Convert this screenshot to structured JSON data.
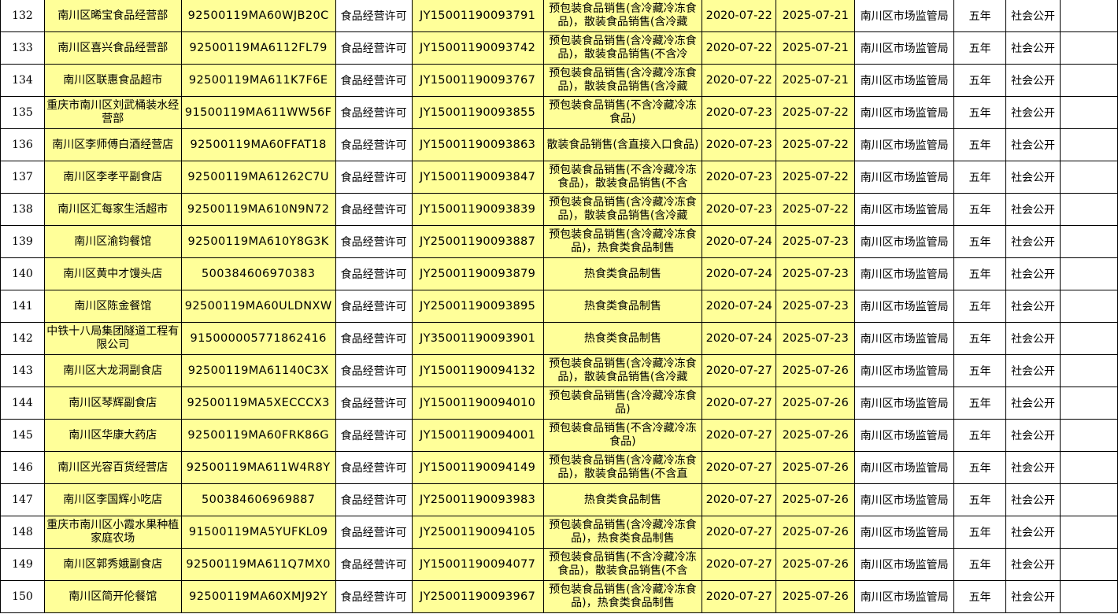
{
  "sheet": {
    "colors": {
      "highlight": "#ffff99",
      "grid": "#000000",
      "note_marker": "#1a7f1a"
    },
    "rows": [
      {
        "no": "132",
        "name": "南川区晞宝食品经营部",
        "code": "92500119MA60WJB20C",
        "type": "食品经营许可",
        "license": "JY15001190093791",
        "scope": "预包装食品销售(含冷藏冷冻食品)，散装食品销售(含冷藏",
        "start": "2020-07-22",
        "end": "2025-07-21",
        "org": "南川区市场监管局",
        "term": "五年",
        "pub": "社会公开"
      },
      {
        "no": "133",
        "name": "南川区喜兴食品经营部",
        "code": "92500119MA6112FL79",
        "type": "食品经营许可",
        "license": "JY15001190093742",
        "scope": "预包装食品销售(含冷藏冷冻食品)，散装食品销售(不含冷",
        "start": "2020-07-22",
        "end": "2025-07-21",
        "org": "南川区市场监管局",
        "term": "五年",
        "pub": "社会公开"
      },
      {
        "no": "134",
        "name": "南川区联惠食品超市",
        "code": "92500119MA611K7F6E",
        "type": "食品经营许可",
        "license": "JY15001190093767",
        "scope": "预包装食品销售(含冷藏冷冻食品)，散装食品销售(含冷藏",
        "start": "2020-07-22",
        "end": "2025-07-21",
        "org": "南川区市场监管局",
        "term": "五年",
        "pub": "社会公开"
      },
      {
        "no": "135",
        "name": "重庆市南川区刘武桶装水经营部",
        "code": "91500119MA611WW56F",
        "type": "食品经营许可",
        "license": "JY15001190093855",
        "scope": "预包装食品销售(不含冷藏冷冻食品)",
        "start": "2020-07-23",
        "end": "2025-07-22",
        "org": "南川区市场监管局",
        "term": "五年",
        "pub": "社会公开"
      },
      {
        "no": "136",
        "name": "南川区李师傅白酒经营店",
        "code": "92500119MA60FFAT18",
        "type": "食品经营许可",
        "license": "JY15001190093863",
        "scope": "散装食品销售(含直接入口食品)",
        "start": "2020-07-23",
        "end": "2025-07-22",
        "org": "南川区市场监管局",
        "term": "五年",
        "pub": "社会公开"
      },
      {
        "no": "137",
        "name": "南川区李孝平副食店",
        "code": "92500119MA61262C7U",
        "type": "食品经营许可",
        "license": "JY15001190093847",
        "scope": "预包装食品销售(不含冷藏冷冻食品)，散装食品销售(不含",
        "start": "2020-07-23",
        "end": "2025-07-22",
        "org": "南川区市场监管局",
        "term": "五年",
        "pub": "社会公开"
      },
      {
        "no": "138",
        "name": "南川区汇每家生活超市",
        "code": "92500119MA610N9N72",
        "type": "食品经营许可",
        "license": "JY15001190093839",
        "scope": "预包装食品销售(含冷藏冷冻食品)，散装食品销售(含冷藏",
        "start": "2020-07-23",
        "end": "2025-07-22",
        "org": "南川区市场监管局",
        "term": "五年",
        "pub": "社会公开"
      },
      {
        "no": "139",
        "name": "南川区渝钧餐馆",
        "code": "92500119MA610Y8G3K",
        "type": "食品经营许可",
        "license": "JY25001190093887",
        "scope": "预包装食品销售(含冷藏冷冻食品)，热食类食品制售",
        "start": "2020-07-24",
        "end": "2025-07-23",
        "org": "南川区市场监管局",
        "term": "五年",
        "pub": "社会公开"
      },
      {
        "no": "140",
        "name": "南川区黄中才馒头店",
        "code": "500384606970383",
        "type": "食品经营许可",
        "license": "JY25001190093879",
        "scope": "热食类食品制售",
        "start": "2020-07-24",
        "end": "2025-07-23",
        "org": "南川区市场监管局",
        "term": "五年",
        "pub": "社会公开"
      },
      {
        "no": "141",
        "name": "南川区陈金餐馆",
        "code": "92500119MA60ULDNXW",
        "type": "食品经营许可",
        "license": "JY25001190093895",
        "scope": "热食类食品制售",
        "start": "2020-07-24",
        "end": "2025-07-23",
        "org": "南川区市场监管局",
        "term": "五年",
        "pub": "社会公开"
      },
      {
        "no": "142",
        "name": "中铁十八局集团隧道工程有限公司",
        "code": "915000005771862416",
        "type": "食品经营许可",
        "license": "JY35001190093901",
        "scope": "热食类食品制售",
        "start": "2020-07-24",
        "end": "2025-07-23",
        "org": "南川区市场监管局",
        "term": "五年",
        "pub": "社会公开"
      },
      {
        "no": "143",
        "name": "南川区大龙洞副食店",
        "code": "92500119MA61140C3X",
        "type": "食品经营许可",
        "license": "JY15001190094132",
        "scope": "预包装食品销售(含冷藏冷冻食品)，散装食品销售(含冷藏",
        "start": "2020-07-27",
        "end": "2025-07-26",
        "org": "南川区市场监管局",
        "term": "五年",
        "pub": "社会公开"
      },
      {
        "no": "144",
        "name": "南川区琴辉副食店",
        "code": "92500119MA5XECCCX3",
        "type": "食品经营许可",
        "license": "JY15001190094010",
        "scope": "预包装食品销售(含冷藏冷冻食品)",
        "start": "2020-07-27",
        "end": "2025-07-26",
        "org": "南川区市场监管局",
        "term": "五年",
        "pub": "社会公开"
      },
      {
        "no": "145",
        "name": "南川区华康大药店",
        "code": "92500119MA60FRK86G",
        "type": "食品经营许可",
        "license": "JY15001190094001",
        "scope": "预包装食品销售(不含冷藏冷冻食品)",
        "start": "2020-07-27",
        "end": "2025-07-26",
        "org": "南川区市场监管局",
        "term": "五年",
        "pub": "社会公开"
      },
      {
        "no": "146",
        "name": "南川区光容百货经营店",
        "code": "92500119MA611W4R8Y",
        "type": "食品经营许可",
        "license": "JY15001190094149",
        "scope": "预包装食品销售(含冷藏冷冻食品)，散装食品销售(不含直",
        "start": "2020-07-27",
        "end": "2025-07-26",
        "org": "南川区市场监管局",
        "term": "五年",
        "pub": "社会公开"
      },
      {
        "no": "147",
        "name": "南川区李国辉小吃店",
        "code": "500384606969887",
        "type": "食品经营许可",
        "license": "JY25001190093983",
        "scope": "热食类食品制售",
        "start": "2020-07-27",
        "end": "2025-07-26",
        "org": "南川区市场监管局",
        "term": "五年",
        "pub": "社会公开"
      },
      {
        "no": "148",
        "name": "重庆市南川区小霞水果种植家庭农场",
        "code": "91500119MA5YUFKL09",
        "type": "食品经营许可",
        "license": "JY25001190094105",
        "scope": "预包装食品销售(含冷藏冷冻食品)，热食类食品制售",
        "start": "2020-07-27",
        "end": "2025-07-26",
        "org": "南川区市场监管局",
        "term": "五年",
        "pub": "社会公开"
      },
      {
        "no": "149",
        "name": "南川区郭秀娥副食店",
        "code": "92500119MA611Q7MX0",
        "type": "食品经营许可",
        "license": "JY15001190094077",
        "scope": "预包装食品销售(不含冷藏冷冻食品)，散装食品销售(不含",
        "start": "2020-07-27",
        "end": "2025-07-26",
        "org": "南川区市场监管局",
        "term": "五年",
        "pub": "社会公开"
      },
      {
        "no": "150",
        "name": "南川区简开伦餐馆",
        "code": "92500119MA60XMJ92Y",
        "type": "食品经营许可",
        "license": "JY25001190093967",
        "scope": "预包装食品销售(含冷藏冷冻食品)，热食类食品制售",
        "start": "2020-07-27",
        "end": "2025-07-26",
        "org": "南川区市场监管局",
        "term": "五年",
        "pub": "社会公开"
      }
    ]
  }
}
